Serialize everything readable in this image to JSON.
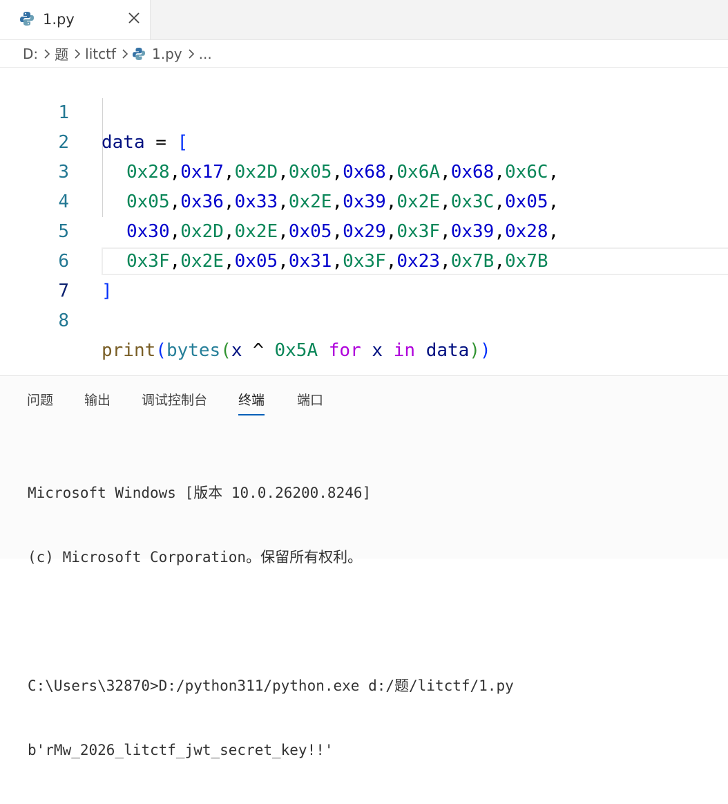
{
  "tab": {
    "title": "1.py",
    "icon": "python-icon"
  },
  "breadcrumb": [
    "D:",
    "题",
    "litctf",
    "1.py",
    "..."
  ],
  "editor": {
    "line_numbers": [
      "1",
      "2",
      "3",
      "4",
      "5",
      "6",
      "7",
      "8"
    ],
    "code": {
      "l1_var": "data",
      "l1_eq": " = ",
      "l1_br": "[",
      "l2": [
        "0x28",
        "0x17",
        "0x2D",
        "0x05",
        "0x68",
        "0x6A",
        "0x68",
        "0x6C"
      ],
      "l3": [
        "0x05",
        "0x36",
        "0x33",
        "0x2E",
        "0x39",
        "0x2E",
        "0x3C",
        "0x05"
      ],
      "l4": [
        "0x30",
        "0x2D",
        "0x2E",
        "0x05",
        "0x29",
        "0x3F",
        "0x39",
        "0x28"
      ],
      "l5": [
        "0x3F",
        "0x2E",
        "0x05",
        "0x31",
        "0x3F",
        "0x23",
        "0x7B",
        "0x7B"
      ],
      "comma": ",",
      "l6_br": "]",
      "l8": {
        "print": "print",
        "p_open": "(",
        "bytes": "bytes",
        "b_open": "(",
        "x1": "x",
        "xor": " ^ ",
        "key": "0x5A",
        "for": "for",
        "x2": "x",
        "in": "in",
        "data": "data",
        "b_close": ")",
        "p_close": ")"
      }
    }
  },
  "panel": {
    "tabs": [
      "问题",
      "输出",
      "调试控制台",
      "终端",
      "端口"
    ],
    "active_tab": "终端",
    "terminal": [
      "Microsoft Windows [版本 10.0.26200.8246]",
      "(c) Microsoft Corporation。保留所有权利。",
      "",
      "C:\\Users\\32870>D:/python311/python.exe d:/题/litctf/1.py",
      "b'rMw_2026_litctf_jwt_secret_key!!'"
    ]
  }
}
